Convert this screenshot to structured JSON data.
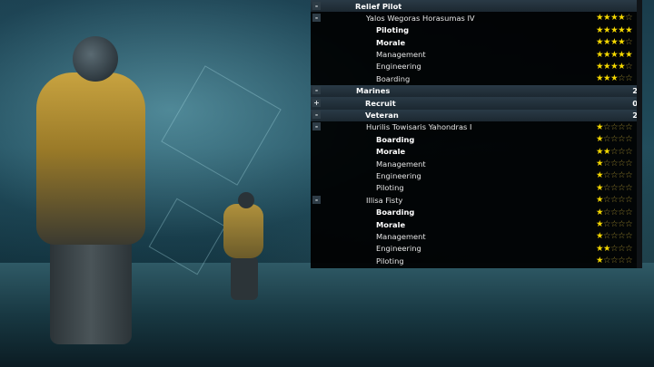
{
  "panel": {
    "rows": [
      {
        "type": "header",
        "indent": 0,
        "toggle": "-",
        "label": "Relief Pilot",
        "value": ""
      },
      {
        "type": "person",
        "toggle": "-",
        "label": "Yalos Wegoras Horasumas IV",
        "stars": 4
      },
      {
        "type": "skill",
        "label": "Piloting",
        "bold": true,
        "stars": 5
      },
      {
        "type": "skill",
        "label": "Morale",
        "bold": true,
        "stars": 4
      },
      {
        "type": "skill",
        "label": "Management",
        "bold": false,
        "stars": 5
      },
      {
        "type": "skill",
        "label": "Engineering",
        "bold": false,
        "stars": 4
      },
      {
        "type": "skill",
        "label": "Boarding",
        "bold": false,
        "stars": 3
      },
      {
        "type": "header",
        "indent": 1,
        "toggle": "-",
        "label": "Marines",
        "value": "2"
      },
      {
        "type": "header",
        "indent": 2,
        "toggle": "+",
        "label": "Recruit",
        "value": "0"
      },
      {
        "type": "header",
        "indent": 2,
        "toggle": "-",
        "label": "Veteran",
        "value": "2"
      },
      {
        "type": "person",
        "toggle": "-",
        "label": "Hurilis Towisaris Yahondras I",
        "stars": 1
      },
      {
        "type": "skill",
        "label": "Boarding",
        "bold": true,
        "stars": 1
      },
      {
        "type": "skill",
        "label": "Morale",
        "bold": true,
        "stars": 2
      },
      {
        "type": "skill",
        "label": "Management",
        "bold": false,
        "stars": 1
      },
      {
        "type": "skill",
        "label": "Engineering",
        "bold": false,
        "stars": 1
      },
      {
        "type": "skill",
        "label": "Piloting",
        "bold": false,
        "stars": 1
      },
      {
        "type": "person",
        "toggle": "-",
        "label": "Illisa Fisty",
        "stars": 1
      },
      {
        "type": "skill",
        "label": "Boarding",
        "bold": true,
        "stars": 1
      },
      {
        "type": "skill",
        "label": "Morale",
        "bold": true,
        "stars": 1
      },
      {
        "type": "skill",
        "label": "Management",
        "bold": false,
        "stars": 1
      },
      {
        "type": "skill",
        "label": "Engineering",
        "bold": false,
        "stars": 2
      },
      {
        "type": "skill",
        "label": "Piloting",
        "bold": false,
        "stars": 1
      }
    ],
    "max_stars": 5
  },
  "colors": {
    "star_on": "#f5d800",
    "star_off": "#a08a30",
    "header_bg": "#2a3a46"
  },
  "icons": {
    "expand": "expand-icon",
    "collapse": "collapse-icon",
    "star": "star-icon"
  }
}
